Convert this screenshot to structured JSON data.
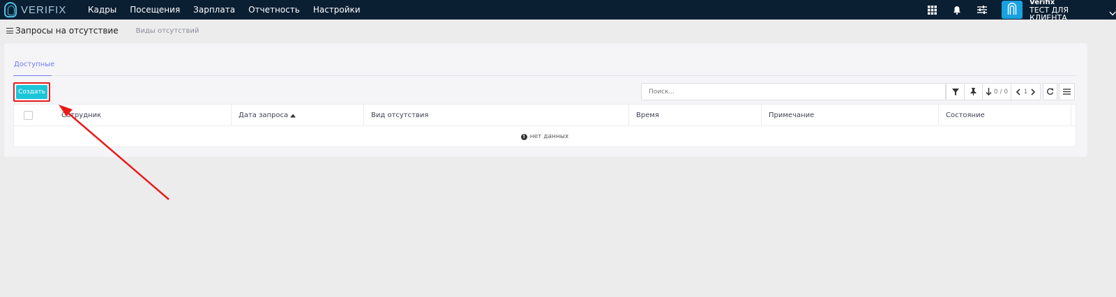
{
  "brand": {
    "logo_text": "VERIFIX"
  },
  "nav": {
    "items": [
      "Кадры",
      "Посещения",
      "Зарплата",
      "Отчетность",
      "Настройки"
    ]
  },
  "user": {
    "name": "Verifix",
    "company": "ТЕСТ ДЛЯ КЛИЕНТА"
  },
  "subheader": {
    "title": "Запросы на отсутствие",
    "secondary_tab": "Виды отсутствий"
  },
  "tabs": {
    "active": "Доступные"
  },
  "toolbar": {
    "create_label": "Создать",
    "search_placeholder": "Поиск...",
    "sort_count": "0 / 0",
    "page_number": "1"
  },
  "table": {
    "columns": [
      "Сотрудник",
      "Дата запроса",
      "Вид отсутствия",
      "Время",
      "Примечание",
      "Состояние"
    ],
    "empty_text": "нет данных"
  },
  "colors": {
    "navbar": "#0b1f33",
    "accent": "#1bc5d8",
    "tab_active": "#6f7cf0",
    "annotation": "#e81b1b"
  }
}
